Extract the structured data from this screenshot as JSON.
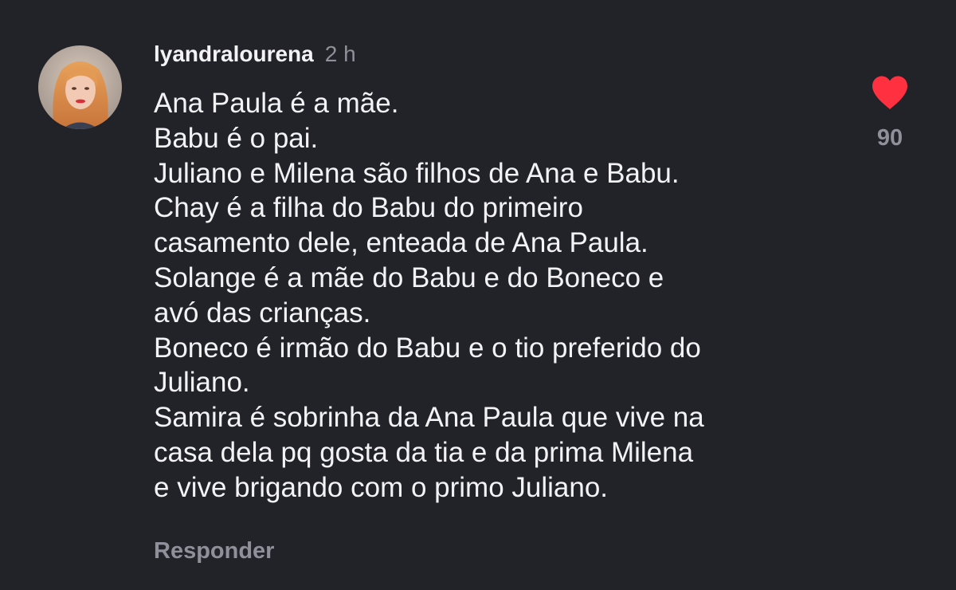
{
  "comment": {
    "username": "lyandralourena",
    "timestamp": "2 h",
    "lines": [
      "Ana Paula é a mãe.",
      "Babu é o pai.",
      "Juliano e Milena são filhos de Ana e Babu.",
      "Chay é a filha do Babu do primeiro",
      "casamento dele, enteada de Ana Paula.",
      "Solange é a mãe do Babu e do Boneco e",
      "avó das crianças.",
      "Boneco é irmão do Babu e o tio preferido do",
      "Juliano.",
      "Samira é sobrinha da Ana Paula que vive na",
      "casa dela pq gosta da tia e da prima Milena",
      "e vive brigando com o primo Juliano."
    ],
    "reply_label": "Responder",
    "like_count": "90",
    "liked": true,
    "like_icon": "heart-icon",
    "colors": {
      "background": "#222229",
      "text": "#f3f3f5",
      "muted": "#8f909a",
      "like": "#ff3040"
    }
  }
}
